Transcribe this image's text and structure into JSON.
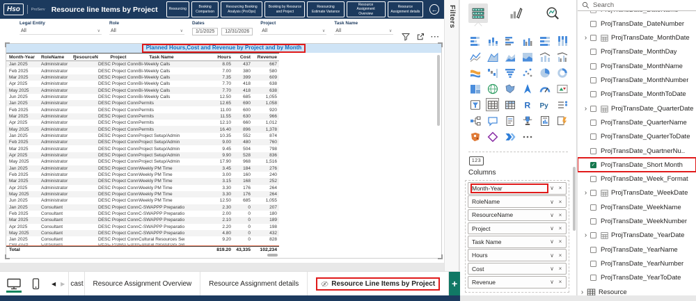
{
  "header": {
    "logo_text": "Hso",
    "app_subtitle": "ProServ",
    "report_title": "Resource line Items by Project",
    "nav_buttons": [
      "Resourcing",
      "Booking Comparison",
      "Resourcing Booking Analysis (ProOps)",
      "Booking by Resource and Project",
      "Resourcing Estimate Variance",
      "Resource Assignment Overview",
      "Resource Assignment details"
    ],
    "back_icon": "←"
  },
  "filter_bar": {
    "filters": [
      {
        "label": "Legal Entity",
        "type": "dropdown",
        "value": "All"
      },
      {
        "label": "Role",
        "type": "dropdown",
        "value": "All"
      },
      {
        "label": "Dates",
        "type": "daterange",
        "start": "1/1/2025",
        "end": "12/31/2026"
      },
      {
        "label": "Project",
        "type": "dropdown",
        "value": "All"
      },
      {
        "label": "Task Name",
        "type": "dropdown",
        "value": "All"
      }
    ]
  },
  "visual_header": {
    "more_label": "···"
  },
  "chart_data": {
    "type": "table",
    "title": "Planned Hours,Cost and Revenue by Project and by Month",
    "columns": [
      "Month-Year",
      "RoleName",
      "ResourceName",
      "Project",
      "Task Name",
      "Hours",
      "Cost",
      "Revenue"
    ],
    "sorted_column": "ResourceName",
    "rows": [
      [
        "Jan 2025",
        "Administrator",
        "",
        "DESC Project Connect",
        "Bi-Weekly Calls",
        "8.05",
        "437",
        "667"
      ],
      [
        "Feb 2025",
        "Administrator",
        "",
        "DESC Project Connect",
        "Bi-Weekly Calls",
        "7.00",
        "380",
        "580"
      ],
      [
        "Mar 2025",
        "Administrator",
        "",
        "DESC Project Connect",
        "Bi-Weekly Calls",
        "7.35",
        "399",
        "609"
      ],
      [
        "Apr 2025",
        "Administrator",
        "",
        "DESC Project Connect",
        "Bi-Weekly Calls",
        "7.70",
        "418",
        "638"
      ],
      [
        "May 2025",
        "Administrator",
        "",
        "DESC Project Connect",
        "Bi-Weekly Calls",
        "7.70",
        "418",
        "638"
      ],
      [
        "Jun 2025",
        "Administrator",
        "",
        "DESC Project Connect",
        "Bi-Weekly Calls",
        "12.50",
        "685",
        "1,055"
      ],
      [
        "Jan 2025",
        "Administrator",
        "",
        "DESC Project Connect",
        "Permits",
        "12.65",
        "690",
        "1,058"
      ],
      [
        "Feb 2025",
        "Administrator",
        "",
        "DESC Project Connect",
        "Permits",
        "11.00",
        "600",
        "920"
      ],
      [
        "Mar 2025",
        "Administrator",
        "",
        "DESC Project Connect",
        "Permits",
        "11.55",
        "630",
        "966"
      ],
      [
        "Apr 2025",
        "Administrator",
        "",
        "DESC Project Connect",
        "Permits",
        "12.10",
        "660",
        "1,012"
      ],
      [
        "May 2025",
        "Administrator",
        "",
        "DESC Project Connect",
        "Permits",
        "16.40",
        "896",
        "1,378"
      ],
      [
        "Jan 2025",
        "Administrator",
        "",
        "DESC Project Connect",
        "Project Setup/Admin",
        "10.35",
        "552",
        "874"
      ],
      [
        "Feb 2025",
        "Administrator",
        "",
        "DESC Project Connect",
        "Project Setup/Admin",
        "9.00",
        "480",
        "760"
      ],
      [
        "Mar 2025",
        "Administrator",
        "",
        "DESC Project Connect",
        "Project Setup/Admin",
        "9.45",
        "504",
        "798"
      ],
      [
        "Apr 2025",
        "Administrator",
        "",
        "DESC Project Connect",
        "Project Setup/Admin",
        "9.90",
        "528",
        "836"
      ],
      [
        "May 2025",
        "Administrator",
        "",
        "DESC Project Connect",
        "Project Setup/Admin",
        "17.90",
        "968",
        "1,516"
      ],
      [
        "Jan 2025",
        "Administrator",
        "",
        "DESC Project Connect",
        "Weekly PM Time",
        "3.45",
        "184",
        "276"
      ],
      [
        "Feb 2025",
        "Administrator",
        "",
        "DESC Project Connect",
        "Weekly PM Time",
        "3.00",
        "160",
        "240"
      ],
      [
        "Mar 2025",
        "Administrator",
        "",
        "DESC Project Connect",
        "Weekly PM Time",
        "3.15",
        "168",
        "252"
      ],
      [
        "Apr 2025",
        "Administrator",
        "",
        "DESC Project Connect",
        "Weekly PM Time",
        "3.30",
        "176",
        "264"
      ],
      [
        "May 2025",
        "Administrator",
        "",
        "DESC Project Connect",
        "Weekly PM Time",
        "3.30",
        "176",
        "264"
      ],
      [
        "Jun 2025",
        "Administrator",
        "",
        "DESC Project Connect",
        "Weekly PM Time",
        "12.50",
        "685",
        "1,055"
      ],
      [
        "Jan 2025",
        "Consultant",
        "",
        "DESC Project Connect",
        "C-SWAPPP Preparation",
        "2.30",
        "0",
        "207"
      ],
      [
        "Feb 2025",
        "Consultant",
        "",
        "DESC Project Connect",
        "C-SWAPPP Preparation",
        "2.00",
        "0",
        "180"
      ],
      [
        "Mar 2025",
        "Consultant",
        "",
        "DESC Project Connect",
        "C-SWAPPP Preparation",
        "2.10",
        "0",
        "189"
      ],
      [
        "Apr 2025",
        "Consultant",
        "",
        "DESC Project Connect",
        "C-SWAPPP Preparation",
        "2.20",
        "0",
        "198"
      ],
      [
        "May 2025",
        "Consultant",
        "",
        "DESC Project Connect",
        "C-SWAPPP Preparation",
        "4.80",
        "0",
        "432"
      ],
      [
        "Jan 2025",
        "Consultant",
        "",
        "DESC Project Connect",
        "Cultural Resources Services",
        "9.20",
        "0",
        "828"
      ]
    ],
    "partial_row": [
      "Feb 2025",
      "Consultant",
      "",
      "DESC Project Connect",
      "Cultural Resources Services",
      "",
      "",
      ""
    ],
    "total_row": {
      "label": "Total",
      "hours": "819.20",
      "cost": "43,335",
      "revenue": "102,234"
    }
  },
  "filters_pane": {
    "label": "Filters"
  },
  "viz_pane": {
    "tabs": [
      {
        "name": "build-visual",
        "selected": true
      },
      {
        "name": "format-visual",
        "selected": false
      },
      {
        "name": "analytics",
        "selected": false
      }
    ],
    "gallery": [
      "stacked-bar-chart",
      "stacked-column-chart",
      "clustered-bar-chart",
      "clustered-column-chart",
      "hundred-stacked-bar-chart",
      "hundred-stacked-column-chart",
      "line-chart",
      "area-chart",
      "stacked-area-chart",
      "hundred-stacked-area-chart",
      "line-and-stacked-column-chart",
      "line-and-clustered-column-chart",
      "ribbon-chart",
      "waterfall-chart",
      "funnel-chart",
      "scatter-chart",
      "pie-chart",
      "donut-chart",
      "treemap",
      "map",
      "filled-map",
      "azure-map",
      "gauge",
      "kpi",
      "slicer",
      "table",
      "matrix",
      "r-script-visual",
      "python-visual",
      "new-slicer",
      "decomposition-tree",
      "q-and-a",
      "smart-narrative",
      "metrics",
      "paginated-report",
      "power-automate",
      "arcgis-map",
      "power-apps",
      "power-automate-flow",
      "more-visuals"
    ],
    "selected_visual": "table",
    "values_icon_label": "123",
    "columns_label": "Columns",
    "column_fields": [
      "Month-Year",
      "RoleName",
      "ResourceName",
      "Project",
      "Task Name",
      "Hours",
      "Cost",
      "Revenue"
    ],
    "annotated_field": "Month-Year"
  },
  "data_pane": {
    "search_placeholder": "Search",
    "fields": [
      {
        "label": "ProjTransDate_DateName",
        "clipped": true
      },
      {
        "label": "ProjTransDate_DateNumber"
      },
      {
        "label": "ProjTransDate_MonthDate",
        "expandable": true,
        "date_icon": true
      },
      {
        "label": "ProjTransDate_MonthDay"
      },
      {
        "label": "ProjTransDate_MonthName"
      },
      {
        "label": "ProjTransDate_MonthNumber"
      },
      {
        "label": "ProjTransDate_MonthToDate"
      },
      {
        "label": "ProjTransDate_QuarterDate",
        "expandable": true,
        "date_icon": true
      },
      {
        "label": "ProjTransDate_QuarterName"
      },
      {
        "label": "ProjTransDate_QuarterToDate"
      },
      {
        "label": "ProjTransDate_QuartnerNu.."
      },
      {
        "label": "ProjTransDate_Short Month",
        "checked": true,
        "annotated": true
      },
      {
        "label": "ProjTransDate_Week_Format"
      },
      {
        "label": "ProjTransDate_WeekDate",
        "expandable": true,
        "date_icon": true
      },
      {
        "label": "ProjTransDate_WeekName"
      },
      {
        "label": "ProjTransDate_WeekNumber"
      },
      {
        "label": "ProjTransDate_YearDate",
        "expandable": true,
        "date_icon": true
      },
      {
        "label": "ProjTransDate_YearName"
      },
      {
        "label": "ProjTransDate_YearNumber"
      },
      {
        "label": "ProjTransDate_YearToDate"
      },
      {
        "label": "Resource",
        "table": true,
        "expandable": true
      }
    ]
  },
  "page_tabs": {
    "clipped_tab": "cast",
    "tabs": [
      "Resource Assignment Overview",
      "Resource Assignment details"
    ],
    "active_tab": "Resource Line Items by Project",
    "new_page_label": "+"
  },
  "colors": {
    "header_navy": "#1c3a5e",
    "title_blue": "#0d6cbf",
    "title_bg": "#cfe4f6",
    "annotation_red": "#e01a1a",
    "accent_green": "#117865",
    "checked_green": "#15784e"
  }
}
